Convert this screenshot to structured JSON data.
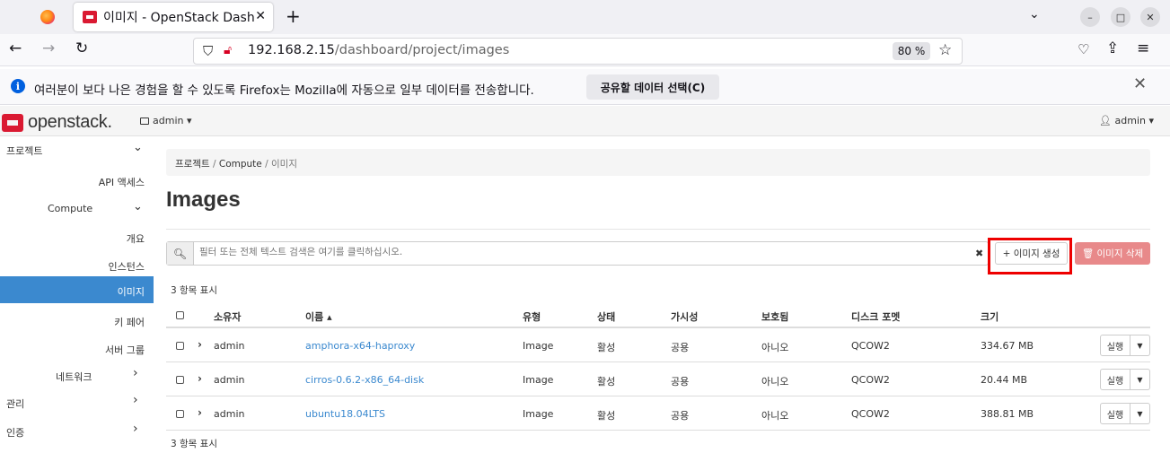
{
  "browser": {
    "tab_title": "이미지 - OpenStack Dashb",
    "tab_close": "✕",
    "new_tab": "+",
    "url_host": "192.168.2.15",
    "url_path": "/dashboard/project/images",
    "zoom": "80 %"
  },
  "notification": {
    "text": "여러분이 보다 나은 경험을 할 수 있도록 Firefox는 Mozilla에 자동으로 일부 데이터를 전송합니다.",
    "button": "공유할 데이터 선택(C)",
    "info_glyph": "i",
    "close_glyph": "✕"
  },
  "header": {
    "logo_text": "openstack.",
    "project": "admin ▾",
    "user": "admin ▾"
  },
  "sidebar": {
    "project": "프로젝트",
    "api_access": "API 액세스",
    "compute": "Compute",
    "overview": "개요",
    "instances": "인스턴스",
    "images": "이미지",
    "keypairs": "키 페어",
    "server_groups": "서버 그룹",
    "network": "네트워크",
    "admin": "관리",
    "identity": "인증"
  },
  "breadcrumb": {
    "project": "프로젝트",
    "sep1": "/",
    "compute": "Compute",
    "sep2": "/",
    "current": "이미지"
  },
  "page": {
    "title": "Images",
    "search_placeholder": "필터 또는 전체 텍스트 검색은 여기를 클릭하십시오.",
    "search_clear": "✖",
    "create_button": "+ 이미지 생성",
    "delete_button": "🗑 이미지 삭제",
    "count_top": "3 항목 표시",
    "count_bottom": "3 항목 표시"
  },
  "table": {
    "headers": {
      "owner": "소유자",
      "name": "이름 ▴",
      "type": "유형",
      "status": "상태",
      "visibility": "가시성",
      "protected": "보호됨",
      "disk_format": "디스크 포멧",
      "size": "크기"
    },
    "rows": [
      {
        "owner": "admin",
        "name": "amphora-x64-haproxy",
        "type": "Image",
        "status": "활성",
        "visibility": "공용",
        "protected": "아니오",
        "disk_format": "QCOW2",
        "size": "334.67 MB",
        "action": "실행"
      },
      {
        "owner": "admin",
        "name": "cirros-0.6.2-x86_64-disk",
        "type": "Image",
        "status": "활성",
        "visibility": "공용",
        "protected": "아니오",
        "disk_format": "QCOW2",
        "size": "20.44 MB",
        "action": "실행"
      },
      {
        "owner": "admin",
        "name": "ubuntu18.04LTS",
        "type": "Image",
        "status": "활성",
        "visibility": "공용",
        "protected": "아니오",
        "disk_format": "QCOW2",
        "size": "388.81 MB",
        "action": "실행"
      }
    ]
  },
  "colors": {
    "accent": "#3b89cf",
    "brand": "#da1a32",
    "highlight": "#ee0000",
    "danger_disabled": "#e8898a"
  }
}
